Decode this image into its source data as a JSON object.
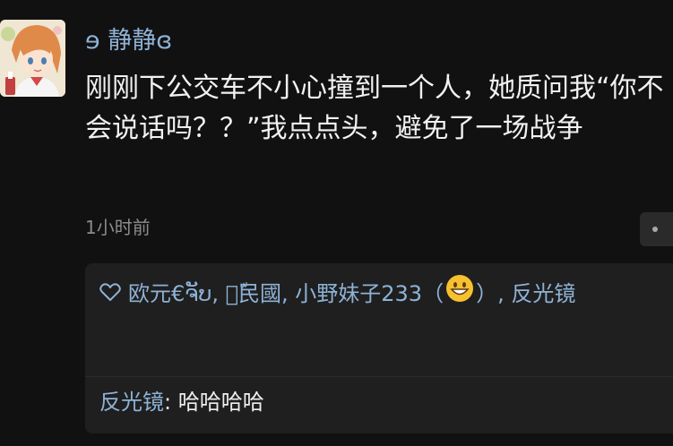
{
  "user": {
    "name": "ɘ 静静ɞ"
  },
  "post": {
    "text": "刚刚下公交车不小心撞到一个人，她质问我“你不会说话吗？？”我点点头，避免了一场战争",
    "time": "1小时前"
  },
  "likes": {
    "icon": "heart-icon",
    "names": "欧元€ຈັບ, 馬ّ民國, 小野妹子233（",
    "emoji": "grinning-face-icon",
    "names_tail": "）, 反光镜"
  },
  "comment": {
    "author": "反光镜",
    "separator": ": ",
    "text": "哈哈哈哈"
  },
  "colors": {
    "background": "#111111",
    "link_blue": "#8eb2d6",
    "text": "#f1f1f1",
    "muted": "#8c8c8c",
    "panel": "#1f1f1f"
  }
}
